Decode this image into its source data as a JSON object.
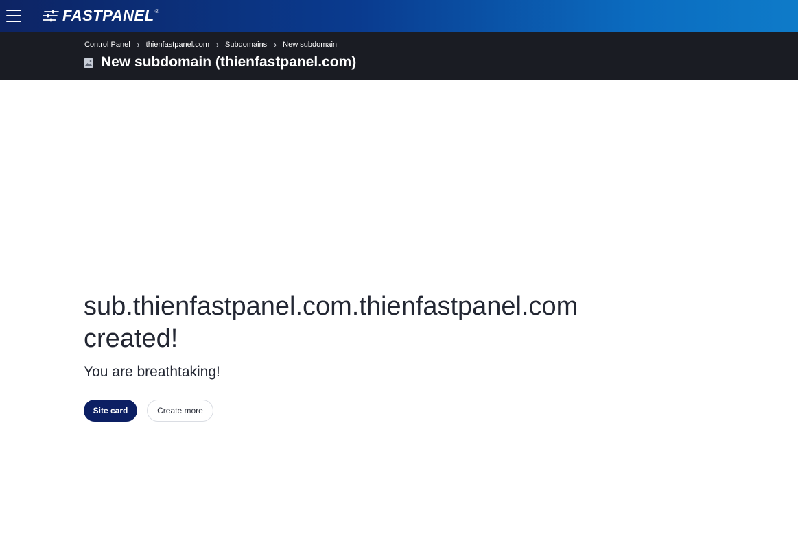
{
  "header": {
    "logo_text": "FASTPANEL",
    "logo_reg": "®",
    "menu_icon": "hamburger-menu-icon",
    "colors": {
      "gradient_start": "#0d2464",
      "gradient_end": "#0e7bc9",
      "subbar": "#1a1c23"
    }
  },
  "breadcrumb": {
    "items": [
      "Control Panel",
      "thienfastpanel.com",
      "Subdomains",
      "New subdomain"
    ],
    "separator": "›"
  },
  "page": {
    "title": "New subdomain (thienfastpanel.com)",
    "title_icon": "image-icon"
  },
  "result": {
    "heading": "sub.thienfastpanel.com.thienfastpanel.com created!",
    "subtext": "You are breathtaking!"
  },
  "actions": {
    "primary_label": "Site card",
    "secondary_label": "Create more",
    "primary_color": "#0c1f63"
  }
}
